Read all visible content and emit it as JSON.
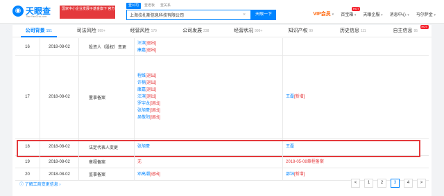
{
  "header": {
    "logo_text": "天眼查",
    "logo_url": "TianYanCha.com",
    "gov_badge": "国家中小企业发展子基金旗下 官方备案企业征信机构",
    "search_tabs": [
      "查公司",
      "查老板",
      "查关系"
    ],
    "search_value": "上海拉扎斯信息科技有限公司",
    "search_button": "天眼一下",
    "nav": {
      "vip": "VIP会员",
      "baibao": "百宝箱",
      "hot": "HOT",
      "enterprise": "天眼企服",
      "messages": "消息中心",
      "user": "马尔萨金"
    }
  },
  "tabs": [
    {
      "label": "公司背景",
      "count": "151"
    },
    {
      "label": "司法风险",
      "count": "999+"
    },
    {
      "label": "经营风险",
      "count": "179"
    },
    {
      "label": "公司发展",
      "count": "238"
    },
    {
      "label": "经营状况",
      "count": "999+"
    },
    {
      "label": "知识产权",
      "count": "99"
    },
    {
      "label": "历史信息",
      "count": "111"
    },
    {
      "label": "自主信息",
      "count": "95",
      "hot": "HOT"
    }
  ],
  "table": {
    "rows": [
      {
        "idx": "16",
        "date": "2018-08-02",
        "item": "投资人（股权）变更",
        "before": [
          {
            "name": "汪滨",
            "tag": "[退出]"
          },
          {
            "name": "康嘉",
            "tag": "[退出]"
          }
        ],
        "after": []
      },
      {
        "idx": "17",
        "date": "2018-08-02",
        "item": "董事备案",
        "before": [
          {
            "name": "程维",
            "tag": "[退出]"
          },
          {
            "name": "许楠",
            "tag": "[退出]"
          },
          {
            "name": "康嘉",
            "tag": "[退出]"
          },
          {
            "name": "汪滨",
            "tag": "[退出]"
          },
          {
            "name": "罗宇龙",
            "tag": "[退出]"
          },
          {
            "name": "张旭豪",
            "tag": "[退出]"
          },
          {
            "name": "吴敬阳",
            "tag": "[退出]"
          }
        ],
        "after": [
          {
            "name": "王磊",
            "tag": "[新增]"
          }
        ]
      },
      {
        "idx": "18",
        "date": "2018-08-02",
        "item": "法定代表人变更",
        "before": [
          {
            "name": "张旭豪",
            "tag": ""
          }
        ],
        "after": [
          {
            "name": "王磊",
            "tag": ""
          }
        ]
      },
      {
        "idx": "19",
        "date": "2018-08-02",
        "item": "章程备案",
        "before_text": "无",
        "after_text": "2018-05-08章程备案"
      },
      {
        "idx": "20",
        "date": "2018-08-02",
        "item": "监事备案",
        "before": [
          {
            "name": "邓高潮",
            "tag": "[退出]"
          }
        ],
        "after": [
          {
            "name": "邵钰",
            "tag": "[新增]"
          }
        ]
      }
    ]
  },
  "footer": {
    "link": "了解工商变更信息",
    "link_arrow": "›",
    "pages": [
      "<",
      "1",
      "2",
      "3",
      "4",
      ">"
    ],
    "active_page": "3"
  },
  "colors": {
    "accent": "#0084ff",
    "danger": "#e4393c"
  }
}
